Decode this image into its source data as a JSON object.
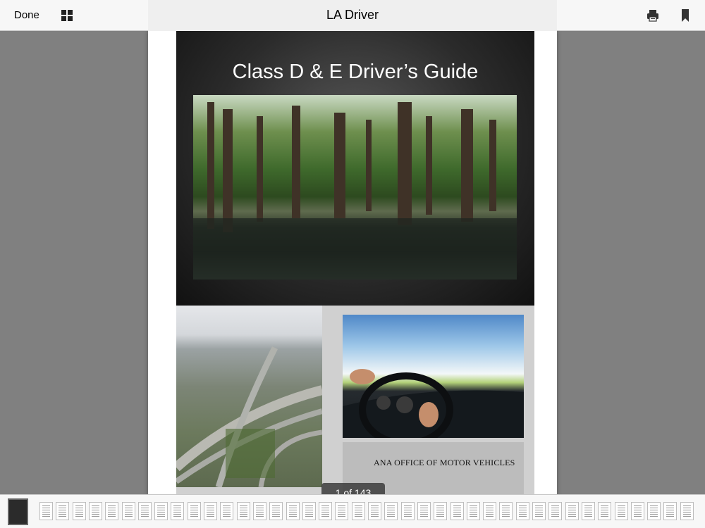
{
  "topbar": {
    "done_label": "Done",
    "title": "LA Driver",
    "icons": [
      "grid-icon",
      "print-icon",
      "bookmark-icon"
    ]
  },
  "document": {
    "cover_title": "Class D & E Driver’s Guide",
    "footer_text": "ANA OFFICE OF MOTOR VEHICLES"
  },
  "page_indicator": "1 of 143",
  "thumbnails": {
    "count": 42,
    "selected_index": 0
  },
  "colors": {
    "viewer_background": "#808080",
    "toolbar_background": "#f7f7f7",
    "cover_dark": "#1a1a1a"
  }
}
